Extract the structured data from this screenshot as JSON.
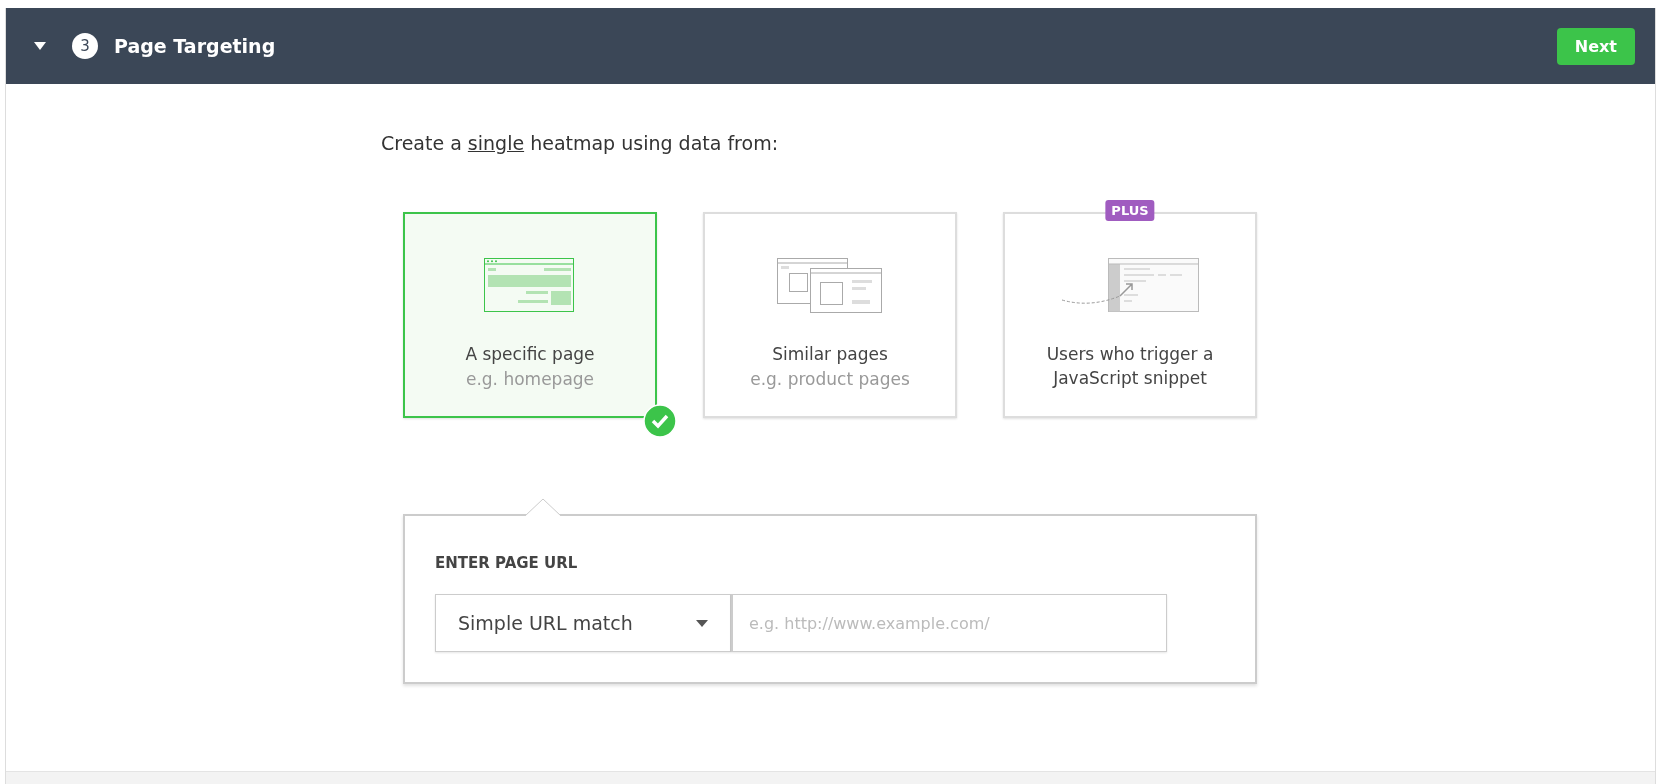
{
  "header": {
    "expanded": true,
    "step": "3",
    "title": "Page Targeting",
    "next_button": "Next"
  },
  "heading": {
    "before": "Create a ",
    "underlined": "single",
    "after": " heatmap using data from:"
  },
  "options": [
    {
      "kind": "single",
      "title": "A specific page",
      "subtitle": "e.g. homepage",
      "selected": true
    },
    {
      "kind": "similar",
      "title": "Similar pages",
      "subtitle": "e.g. product pages",
      "selected": false
    },
    {
      "kind": "snippet",
      "title": "Users who trigger a JavaScript snippet",
      "badge": "PLUS",
      "selected": false
    }
  ],
  "url_panel": {
    "label": "ENTER PAGE URL",
    "match_type": "Simple URL match",
    "url_placeholder": "e.g. http://www.example.com/"
  }
}
